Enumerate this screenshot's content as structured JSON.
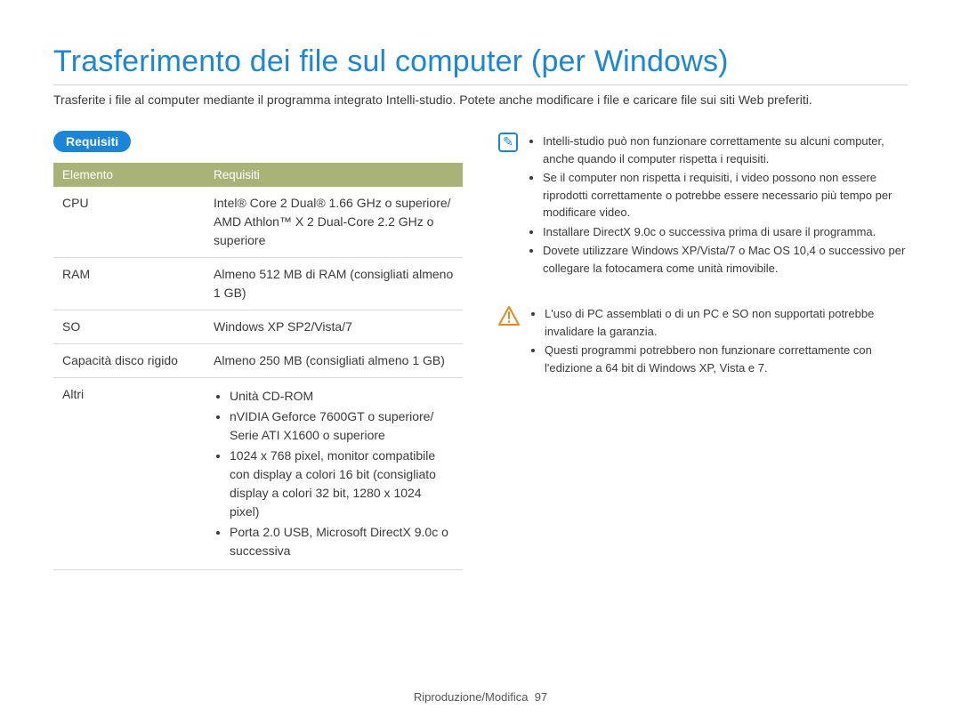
{
  "title": "Trasferimento dei file sul computer (per Windows)",
  "intro": "Trasferite i file al computer mediante il programma integrato Intelli-studio. Potete anche modificare i file e caricare file sui siti Web preferiti.",
  "section_label": "Requisiti",
  "table": {
    "headers": {
      "element": "Elemento",
      "requirement": "Requisiti"
    },
    "rows": {
      "cpu": {
        "label": "CPU",
        "value": "Intel® Core 2 Dual® 1.66 GHz o superiore/ AMD Athlon™ X 2 Dual-Core 2.2 GHz o superiore"
      },
      "ram": {
        "label": "RAM",
        "value": "Almeno 512 MB di RAM (consigliati almeno 1 GB)"
      },
      "os": {
        "label": "SO",
        "value": "Windows XP SP2/Vista/7"
      },
      "disk": {
        "label": "Capacità disco rigido",
        "value": "Almeno 250 MB (consigliati almeno 1 GB)"
      },
      "other": {
        "label": "Altri",
        "items": [
          "Unità CD-ROM",
          "nVIDIA Geforce 7600GT o superiore/ Serie ATI X1600 o superiore",
          "1024 x 768 pixel, monitor compatibile con display a colori 16 bit (consigliato display a colori 32 bit, 1280 x 1024 pixel)",
          "Porta 2.0 USB, Microsoft DirectX 9.0c o successiva"
        ]
      }
    }
  },
  "info_notes": [
    "Intelli-studio può non funzionare correttamente su alcuni computer, anche quando il computer rispetta i requisiti.",
    "Se il computer non rispetta i requisiti, i video possono non essere riprodotti correttamente o potrebbe essere necessario più tempo per modificare video.",
    "Installare DirectX 9.0c o successiva prima di usare il programma.",
    "Dovete utilizzare Windows XP/Vista/7 o Mac OS 10,4 o successivo per collegare la fotocamera come unità rimovibile."
  ],
  "warn_notes": [
    "L'uso di PC assemblati o di un PC e SO non supportati potrebbe invalidare la garanzia.",
    "Questi programmi potrebbero non funzionare correttamente con l'edizione a 64 bit di Windows XP, Vista e 7."
  ],
  "footer": {
    "section": "Riproduzione/Modifica",
    "page": "97"
  }
}
